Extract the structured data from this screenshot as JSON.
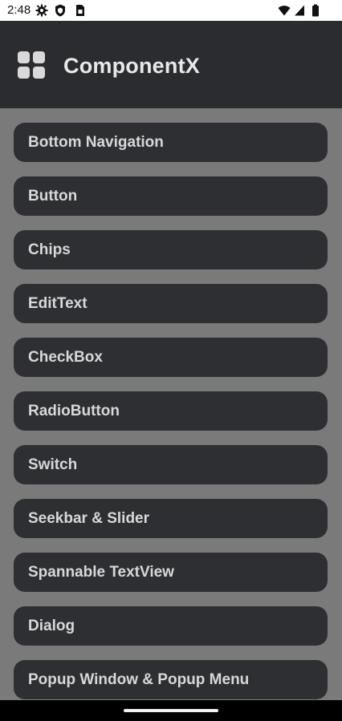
{
  "status_bar": {
    "time": "2:48",
    "left_icons": [
      "gear-icon",
      "shield-icon",
      "sim-card-icon"
    ],
    "right_icons": [
      "wifi-icon",
      "signal-icon",
      "battery-icon"
    ]
  },
  "app_bar": {
    "title": "ComponentX",
    "logo_icon": "grid-apps-icon",
    "background": "#2b2c30"
  },
  "list": {
    "background": "#7a7a7a",
    "item_color": "#2e2f33",
    "items": [
      {
        "label": "Bottom Navigation"
      },
      {
        "label": "Button"
      },
      {
        "label": "Chips"
      },
      {
        "label": "EditText"
      },
      {
        "label": "CheckBox"
      },
      {
        "label": "RadioButton"
      },
      {
        "label": "Switch"
      },
      {
        "label": "Seekbar & Slider"
      },
      {
        "label": "Spannable TextView"
      },
      {
        "label": "Dialog"
      },
      {
        "label": "Popup Window & Popup Menu"
      }
    ]
  }
}
